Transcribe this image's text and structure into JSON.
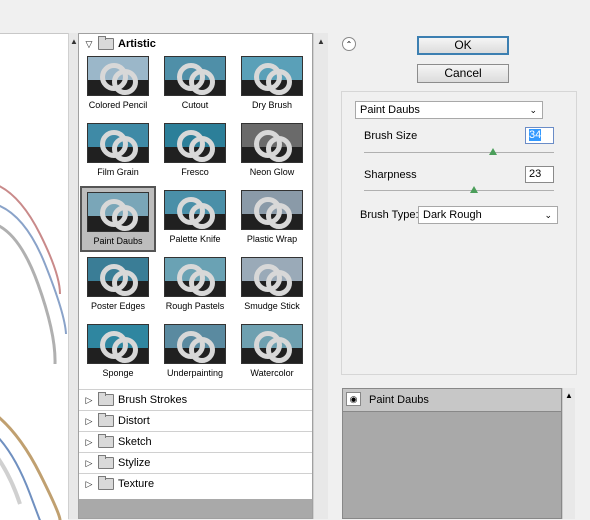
{
  "buttons": {
    "ok": "OK",
    "cancel": "Cancel"
  },
  "gallery": {
    "open_category": "Artistic",
    "filters": [
      {
        "label": "Colored Pencil",
        "selected": false
      },
      {
        "label": "Cutout",
        "selected": false
      },
      {
        "label": "Dry Brush",
        "selected": false
      },
      {
        "label": "Film Grain",
        "selected": false
      },
      {
        "label": "Fresco",
        "selected": false
      },
      {
        "label": "Neon Glow",
        "selected": false
      },
      {
        "label": "Paint Daubs",
        "selected": true
      },
      {
        "label": "Palette Knife",
        "selected": false
      },
      {
        "label": "Plastic Wrap",
        "selected": false
      },
      {
        "label": "Poster Edges",
        "selected": false
      },
      {
        "label": "Rough Pastels",
        "selected": false
      },
      {
        "label": "Smudge Stick",
        "selected": false
      },
      {
        "label": "Sponge",
        "selected": false
      },
      {
        "label": "Underpainting",
        "selected": false
      },
      {
        "label": "Watercolor",
        "selected": false
      }
    ],
    "categories": [
      "Brush Strokes",
      "Distort",
      "Sketch",
      "Stylize",
      "Texture"
    ]
  },
  "settings": {
    "filter_select": "Paint Daubs",
    "brush_size_label": "Brush Size",
    "brush_size_value": "34",
    "brush_size_fraction": 0.68,
    "sharpness_label": "Sharpness",
    "sharpness_value": "23",
    "sharpness_fraction": 0.58,
    "brush_type_label": "Brush Type:",
    "brush_type_value": "Dark Rough"
  },
  "layers": {
    "active_layer": "Paint Daubs"
  },
  "colors": {
    "accent": "#3c7fb1",
    "slider_knob": "#4b9e5a",
    "selection": "#3399ff"
  }
}
